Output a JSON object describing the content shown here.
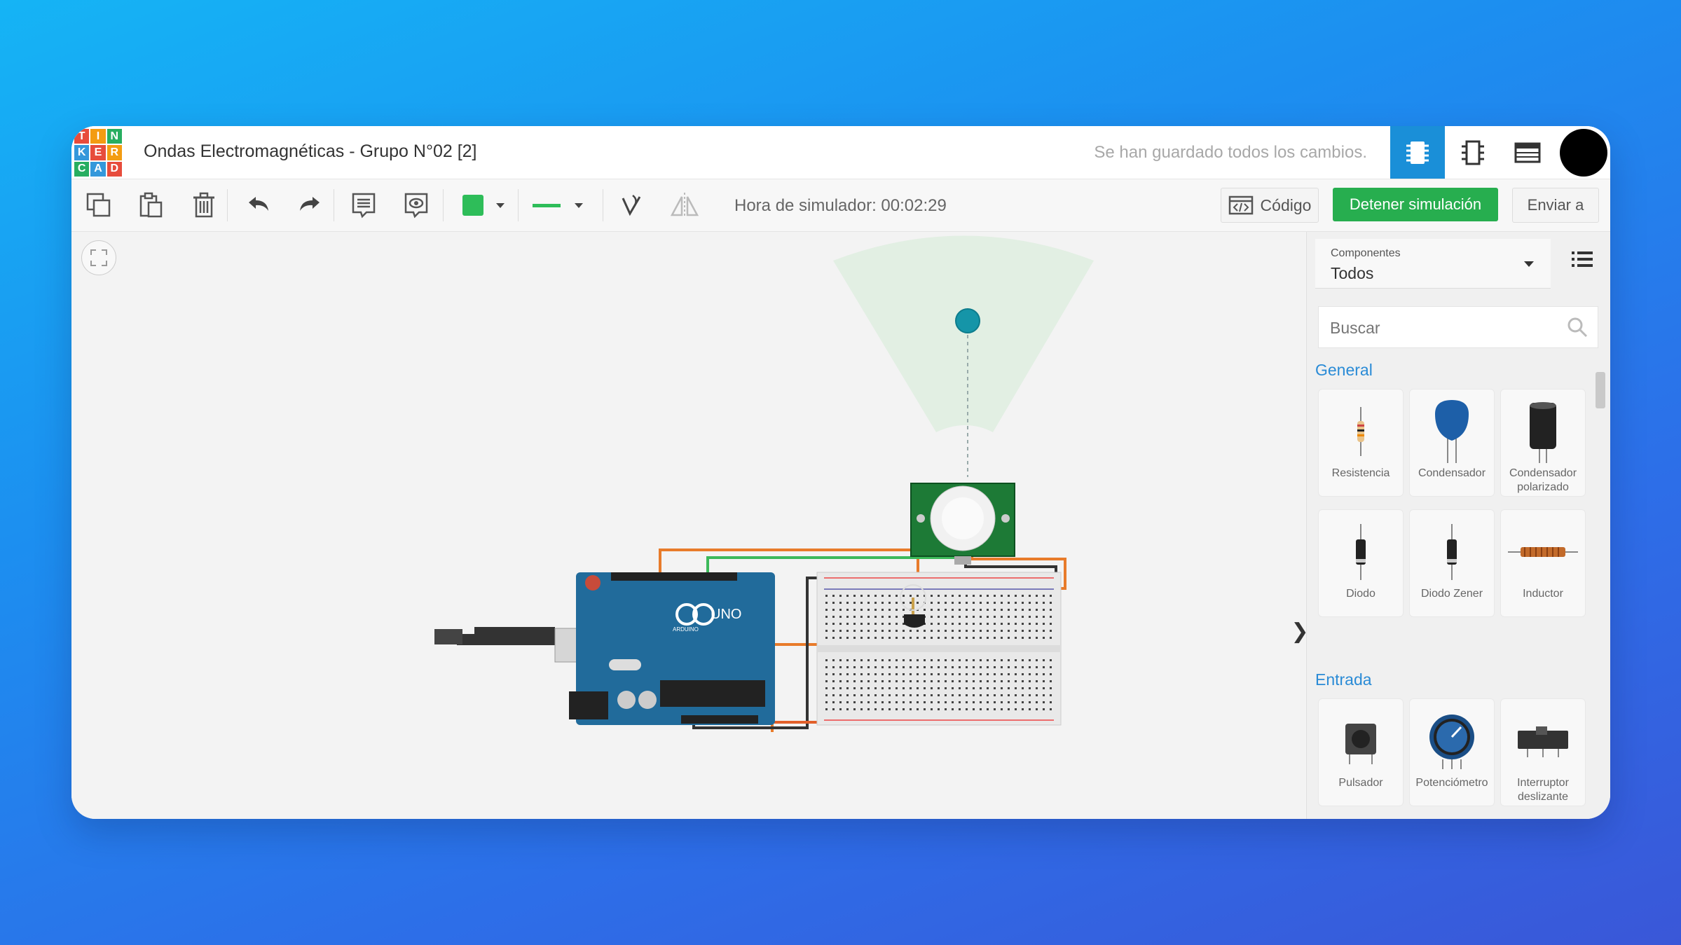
{
  "app": {
    "logo_letters": [
      "T",
      "I",
      "N",
      "K",
      "E",
      "R",
      "C",
      "A",
      "D"
    ],
    "logo_colors": [
      "#e74c3c",
      "#f39c12",
      "#27ae60",
      "#3498db",
      "#e74c3c",
      "#f39c12",
      "#27ae60",
      "#3498db",
      "#e74c3c"
    ],
    "title": "Ondas Electromagnéticas - Grupo N°02 [2]",
    "save_status": "Se han guardado todos los cambios."
  },
  "toolbar": {
    "sim_time": "Hora de simulador: 00:02:29",
    "code_label": "Código",
    "stop_label": "Detener simulación",
    "send_label": "Enviar a",
    "fill_color": "#2ebd59",
    "stop_color": "#27ae4f"
  },
  "canvas": {
    "arduino_label": "UNO",
    "arduino_brand": "ARDUINO"
  },
  "sidebar": {
    "components_label": "Componentes",
    "components_value": "Todos",
    "search_placeholder": "Buscar",
    "sections": [
      {
        "title": "General",
        "items": [
          {
            "name": "Resistencia",
            "icon": "resistor-icon"
          },
          {
            "name": "Condensador",
            "icon": "capacitor-icon"
          },
          {
            "name": "Condensador polarizado",
            "icon": "polarized-capacitor-icon"
          },
          {
            "name": "Diodo",
            "icon": "diode-icon"
          },
          {
            "name": "Diodo Zener",
            "icon": "zener-diode-icon"
          },
          {
            "name": "Inductor",
            "icon": "inductor-icon"
          }
        ]
      },
      {
        "title": "Entrada",
        "items": [
          {
            "name": "Pulsador",
            "icon": "pushbutton-icon"
          },
          {
            "name": "Potenciómetro",
            "icon": "potentiometer-icon"
          },
          {
            "name": "Interruptor deslizante",
            "icon": "slide-switch-icon"
          }
        ]
      }
    ]
  }
}
